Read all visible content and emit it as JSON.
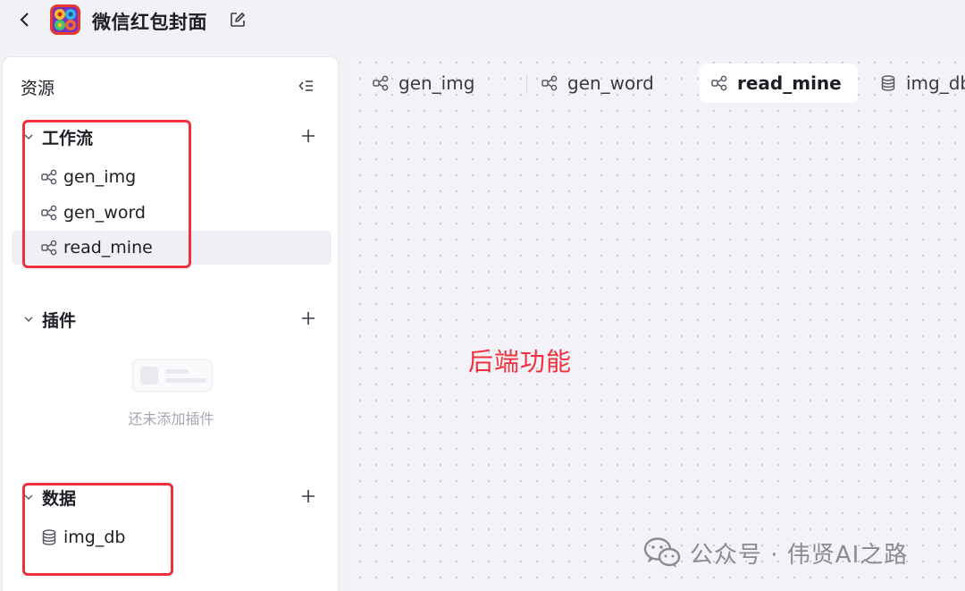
{
  "header": {
    "title": "微信红包封面"
  },
  "sidebar": {
    "title": "资源",
    "sections": {
      "workflow": {
        "label": "工作流",
        "items": [
          "gen_img",
          "gen_word",
          "read_mine"
        ],
        "active_item": "read_mine"
      },
      "plugins": {
        "label": "插件",
        "empty_text": "还未添加插件"
      },
      "data": {
        "label": "数据",
        "items": [
          "img_db"
        ]
      }
    }
  },
  "tabs": [
    {
      "label": "gen_img",
      "icon": "workflow-icon"
    },
    {
      "label": "gen_word",
      "icon": "workflow-icon"
    },
    {
      "label": "read_mine",
      "icon": "workflow-icon",
      "active": true
    },
    {
      "label": "img_db",
      "icon": "database-icon"
    }
  ],
  "annotation": "后端功能",
  "watermark": "公众号 · 伟贤AI之路",
  "colors": {
    "annotation_red": "#f0313d",
    "page_bg": "#f1f1f6",
    "panel_bg": "#ffffff",
    "active_item_bg": "#f0f0f4"
  }
}
